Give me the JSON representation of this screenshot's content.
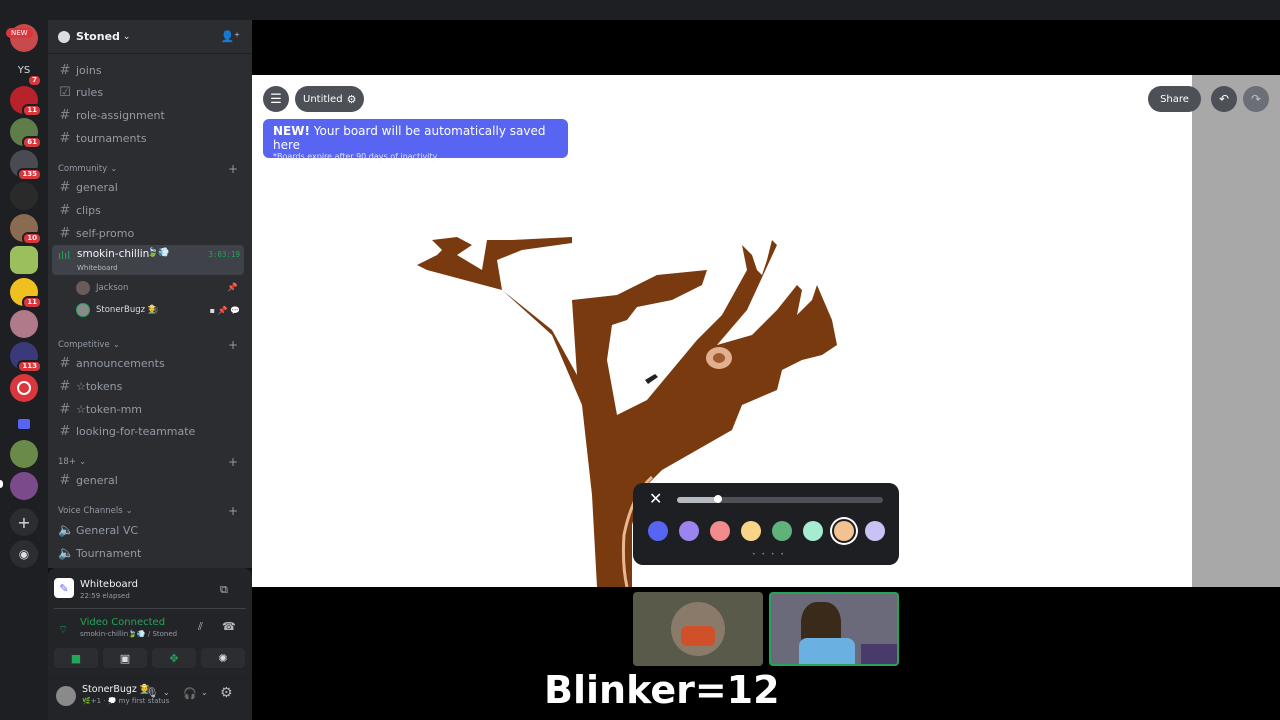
{
  "server": {
    "name": "Stoned",
    "new_badge": "NEW",
    "ys_label": "YS"
  },
  "rail_badges": [
    "7",
    "11",
    "61",
    "135",
    "10",
    "11",
    "113"
  ],
  "channels_top": [
    "joins",
    "rules",
    "role-assignment",
    "tournaments"
  ],
  "categories": {
    "community": "Community",
    "competitive": "Competitive",
    "adult": "18+",
    "voice": "Voice Channels"
  },
  "community_channels": [
    "general",
    "clips",
    "self-promo"
  ],
  "active_voice": {
    "name": "smokin-chillin",
    "emojis": "🍃💨",
    "timer": "3:03:19",
    "activity": "Whiteboard"
  },
  "voice_members": [
    {
      "name": "Jackson"
    },
    {
      "name": "StonerBugz 🧑‍🌾"
    }
  ],
  "competitive_channels": [
    "announcements",
    "☆tokens",
    "☆token-mm",
    "looking-for-teammate"
  ],
  "adult_channels": [
    "general"
  ],
  "voice_channels": [
    "General VC",
    "Tournament"
  ],
  "activity_panel": {
    "title": "Whiteboard",
    "elapsed": "22:59 elapsed"
  },
  "connection": {
    "status": "Video Connected",
    "location": "smokin-chillin🍃💨 / Stoned"
  },
  "user": {
    "name": "StonerBugz 🧑‍🌾",
    "status": "🌿+1 · 💭 my first status"
  },
  "board": {
    "title": "Untitled",
    "share_label": "Share",
    "notice_title": "NEW!",
    "notice_text": "Your board will be automatically saved here",
    "notice_sub": "*Boards expire after 90 days of inactivity"
  },
  "palette": {
    "colors": [
      "#5865f2",
      "#9b84ee",
      "#f28b8b",
      "#f7d488",
      "#5fb37a",
      "#a7ecd2",
      "#f2c291",
      "#c9c3f5"
    ],
    "selected_index": 6,
    "brush_size": 0.2
  },
  "overlay_text": "Blinker=12",
  "colors": {
    "accent_green": "#23a55a",
    "brown": "#7a3a10",
    "blurple": "#5865f2"
  }
}
